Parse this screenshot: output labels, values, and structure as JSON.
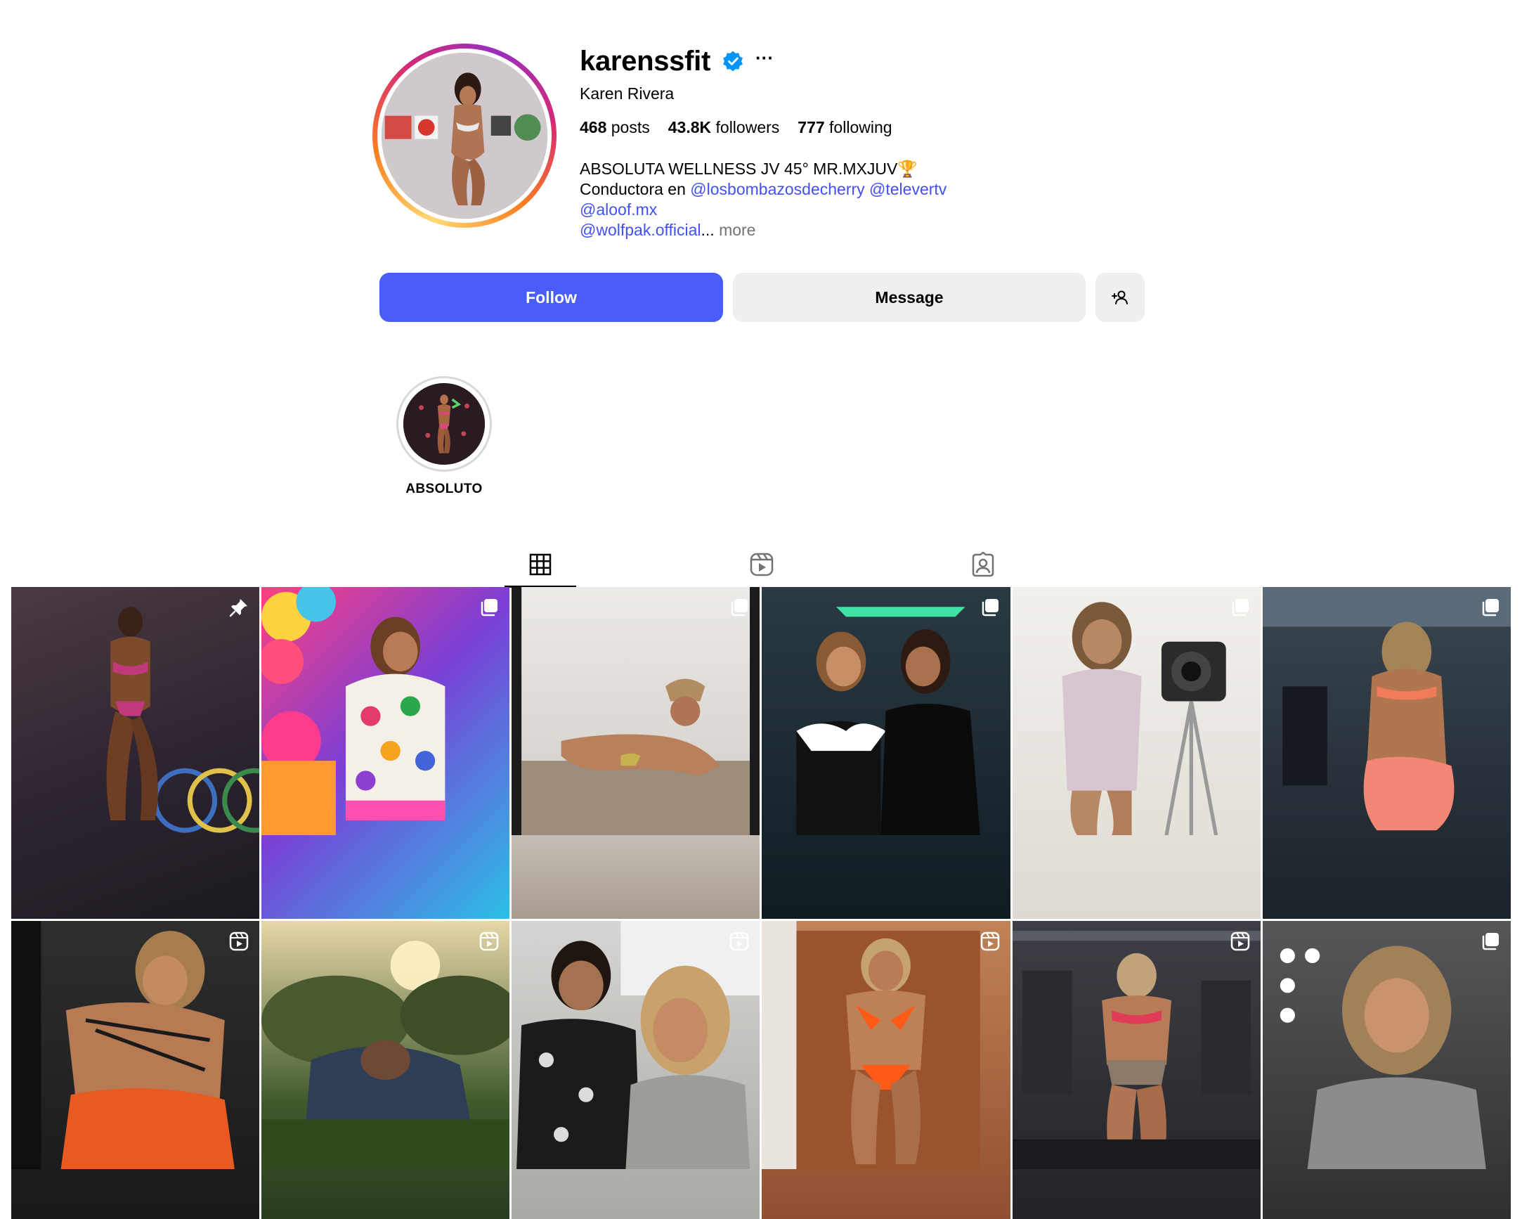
{
  "profile": {
    "username": "karenssfit",
    "full_name": "Karen Rivera",
    "verified_icon": "verified-badge-icon",
    "more_icon": "more-options-icon",
    "more_label": "···"
  },
  "stats": {
    "posts_count": "468",
    "posts_label": "posts",
    "followers_count": "43.8K",
    "followers_label": "followers",
    "following_count": "777",
    "following_label": "following"
  },
  "bio": {
    "line1": "ABSOLUTA WELLNESS JV 45° MR.MXJUV🏆",
    "line2_prefix": "Conductora en",
    "mention1": "@losbombazosdecherry",
    "mention2": "@televertv",
    "mention3": "@aloof.mx",
    "mention4": "@wolfpak.official",
    "ellipsis": "...",
    "more_label": "more"
  },
  "actions": {
    "follow_label": "Follow",
    "message_label": "Message",
    "suggest_icon": "add-person-icon"
  },
  "highlights": [
    {
      "label": "ABSOLUTO"
    }
  ],
  "tabs": {
    "posts_icon": "grid-icon",
    "reels_icon": "reels-icon",
    "tagged_icon": "tagged-icon",
    "active": "posts"
  },
  "colors": {
    "accent_blue": "#4a5df9",
    "mention_blue": "#4150f7",
    "secondary_button": "#efeff1",
    "muted_text": "#737373",
    "verified_blue": "#0095f6"
  },
  "posts": [
    {
      "badge": "pinned-icon"
    },
    {
      "badge": "carousel-icon"
    },
    {
      "badge": "carousel-icon"
    },
    {
      "badge": "carousel-icon"
    },
    {
      "badge": "carousel-icon"
    },
    {
      "badge": "carousel-icon"
    },
    {
      "badge": "reel-icon"
    },
    {
      "badge": "reel-icon"
    },
    {
      "badge": "reel-icon"
    },
    {
      "badge": "reel-icon"
    },
    {
      "badge": "reel-icon"
    },
    {
      "badge": "carousel-icon"
    }
  ]
}
